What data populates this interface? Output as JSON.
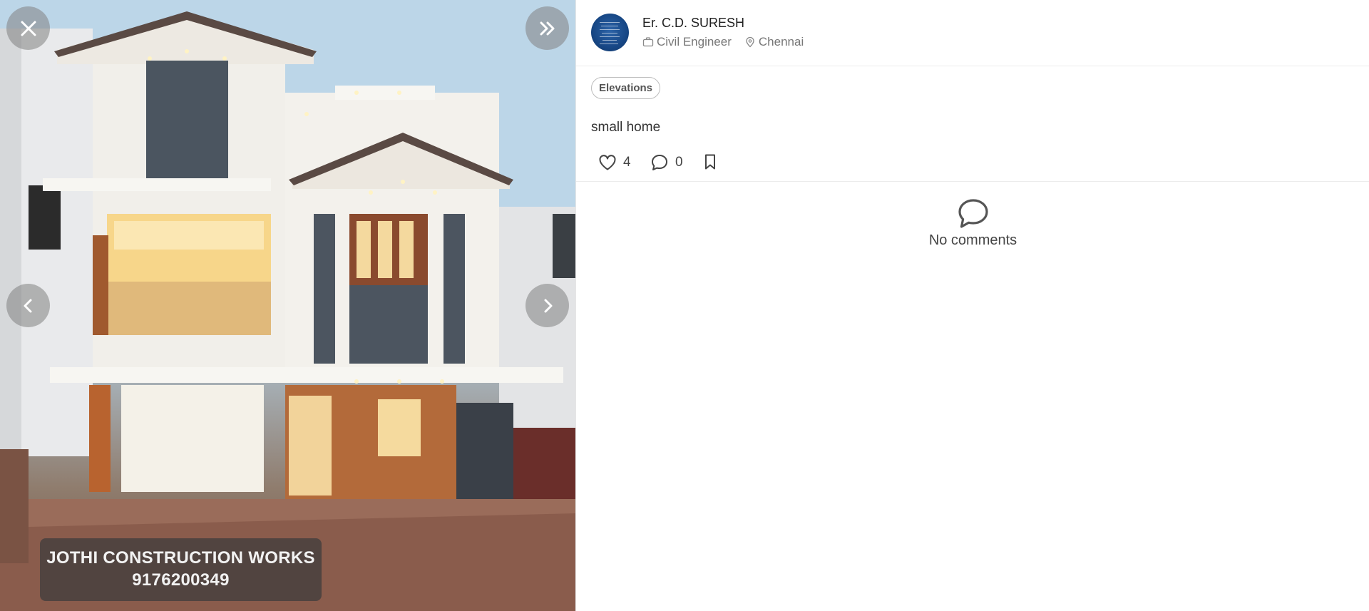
{
  "viewer": {
    "close_icon": "close-icon",
    "expand_icon": "double-chevron-right-icon",
    "prev_icon": "chevron-left-icon",
    "next_icon": "chevron-right-icon",
    "watermark": {
      "line1": "JOTHI CONSTRUCTION WORKS",
      "line2": "9176200349"
    }
  },
  "author": {
    "name": "Er. C.D. SURESH",
    "role": "Civil Engineer",
    "role_icon": "briefcase-icon",
    "location": "Chennai",
    "location_icon": "map-pin-icon"
  },
  "post": {
    "tag": "Elevations",
    "caption": "small home",
    "likes": "4",
    "comments": "0"
  },
  "comments_section": {
    "empty_icon": "speech-bubble-icon",
    "empty_text": "No comments"
  },
  "colors": {
    "accent_avatar": "#174785",
    "text_primary": "#222222",
    "text_muted": "#777777"
  }
}
